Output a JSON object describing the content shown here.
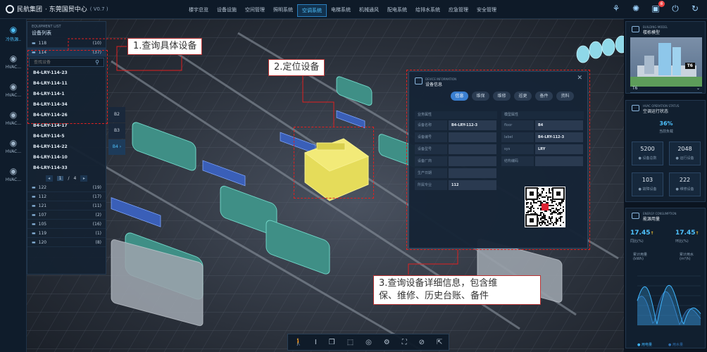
{
  "header": {
    "brand": "民航集团",
    "center": "· 东莞国贸中心",
    "version": "( V0.7 )",
    "nav": [
      {
        "label": "楼宇总览",
        "active": false
      },
      {
        "label": "设备设施",
        "active": false
      },
      {
        "label": "空间管理",
        "active": false
      },
      {
        "label": "照明系统",
        "active": false
      },
      {
        "label": "空调系统",
        "active": true
      },
      {
        "label": "电梯系统",
        "active": false
      },
      {
        "label": "机械通风",
        "active": false
      },
      {
        "label": "配电系统",
        "active": false
      },
      {
        "label": "给排水系统",
        "active": false
      },
      {
        "label": "应急管理",
        "active": false
      },
      {
        "label": "安全管理",
        "active": false
      }
    ],
    "notification_count": "6"
  },
  "rail": {
    "items": [
      {
        "label": "冷热源..",
        "icon": "gauge-icon",
        "active": true
      },
      {
        "label": "HVAC...",
        "icon": "gauge-icon",
        "active": false
      },
      {
        "label": "HVAC...",
        "icon": "gauge-icon",
        "active": false
      },
      {
        "label": "HVAC...",
        "icon": "gauge-icon",
        "active": false
      },
      {
        "label": "HVAC...",
        "icon": "gauge-icon",
        "active": false
      },
      {
        "label": "HVAC...",
        "icon": "gauge-icon",
        "active": false
      }
    ]
  },
  "equipment": {
    "title_en": "EQUIPMENT LIST",
    "title_cn": "设备列表",
    "top_group": {
      "name": "118",
      "count": "(10)"
    },
    "open_group": {
      "name": "114",
      "count": "(37)"
    },
    "search_placeholder": "查找设备",
    "devices": [
      "B4-LRY-114-23",
      "B4-LRY-114-11",
      "B4-LRY-114-1",
      "B4-LRY-114-34",
      "B4-LRY-114-26",
      "B4-LRY-114-17",
      "B4-LRY-114-5",
      "B4-LRY-114-22",
      "B4-LRY-114-10",
      "B4-LRY-114-33"
    ],
    "pager": {
      "prev": "◂",
      "current": "1",
      "sep": "/",
      "total": "4",
      "next": "▸"
    },
    "groups": [
      {
        "name": "122",
        "count": "(19)"
      },
      {
        "name": "112",
        "count": "(17)"
      },
      {
        "name": "121",
        "count": "(11)"
      },
      {
        "name": "107",
        "count": "(2)"
      },
      {
        "name": "105",
        "count": "(16)"
      },
      {
        "name": "119",
        "count": "(1)"
      },
      {
        "name": "120",
        "count": "(8)"
      }
    ]
  },
  "floors": [
    {
      "label": "B2",
      "active": false
    },
    {
      "label": "B3",
      "active": false
    },
    {
      "label": "B4 ›",
      "active": true
    }
  ],
  "annotations": {
    "a1": "1.查询具体设备",
    "a2": "2.定位设备",
    "a3_line1": "3.查询设备详细信息，包含维",
    "a3_line2": "保、维修、历史台账、备件"
  },
  "dialog": {
    "title_en": "DEVICE INFORMATION",
    "title_cn": "设备信息",
    "tabs": [
      {
        "label": "信息",
        "active": true
      },
      {
        "label": "维保",
        "active": false
      },
      {
        "label": "维修",
        "active": false
      },
      {
        "label": "巡更",
        "active": false
      },
      {
        "label": "备件",
        "active": false
      },
      {
        "label": "资料",
        "active": false
      }
    ],
    "left_section": "业务属性",
    "right_section": "模型属性",
    "left_fields": [
      {
        "k": "设备名称",
        "v": "B4-LRY-112-3"
      },
      {
        "k": "设备编号",
        "v": ""
      },
      {
        "k": "设备型号",
        "v": ""
      },
      {
        "k": "设备厂商",
        "v": ""
      },
      {
        "k": "生产日期",
        "v": ""
      },
      {
        "k": "所属专业",
        "v": "112"
      }
    ],
    "right_fields": [
      {
        "k": "floor",
        "v": "B4"
      },
      {
        "k": "label",
        "v": "B4-LRY-112-3"
      },
      {
        "k": "sys",
        "v": "LRY"
      },
      {
        "k": "结构编码",
        "v": ""
      }
    ]
  },
  "model_panel": {
    "title_en": "BUILDING MODEL",
    "title_cn": "楼栋模型",
    "tag": "T6",
    "selected": "T6"
  },
  "status_panel": {
    "title_en": "HVAC OPERATION STATUS",
    "title_cn": "空调运行状态",
    "percent": "36%",
    "percent_label": "当前负载",
    "stats": [
      {
        "n": "5200",
        "l": "● 设备总数"
      },
      {
        "n": "2048",
        "l": "● 运行设备"
      },
      {
        "n": "103",
        "l": "● 故障设备"
      },
      {
        "n": "222",
        "l": "● 维修设备"
      }
    ]
  },
  "energy_panel": {
    "title_en": "ENERGY CONSUMPTION",
    "title_cn": "能源用量",
    "left_value": "17.45",
    "left_arrow": "↑",
    "left_label": "同比(%)",
    "right_value": "17.45",
    "right_arrow": "↑",
    "right_label": "环比(%)",
    "unit_left_title": "累计用量",
    "unit_left": "(kWh)",
    "unit_right_title": "累计用水",
    "unit_right": "(m³/h)",
    "legend": [
      "● 用电量",
      "● 用水量"
    ],
    "colors": {
      "line1": "#3fb6ff",
      "line2": "#2f6fb0"
    }
  },
  "toolbar": {
    "icons": [
      "walk-icon",
      "text-icon",
      "cube-icon",
      "box-icon",
      "compass-icon",
      "gear-icon",
      "frame-icon",
      "measure-icon",
      "export-icon"
    ]
  }
}
